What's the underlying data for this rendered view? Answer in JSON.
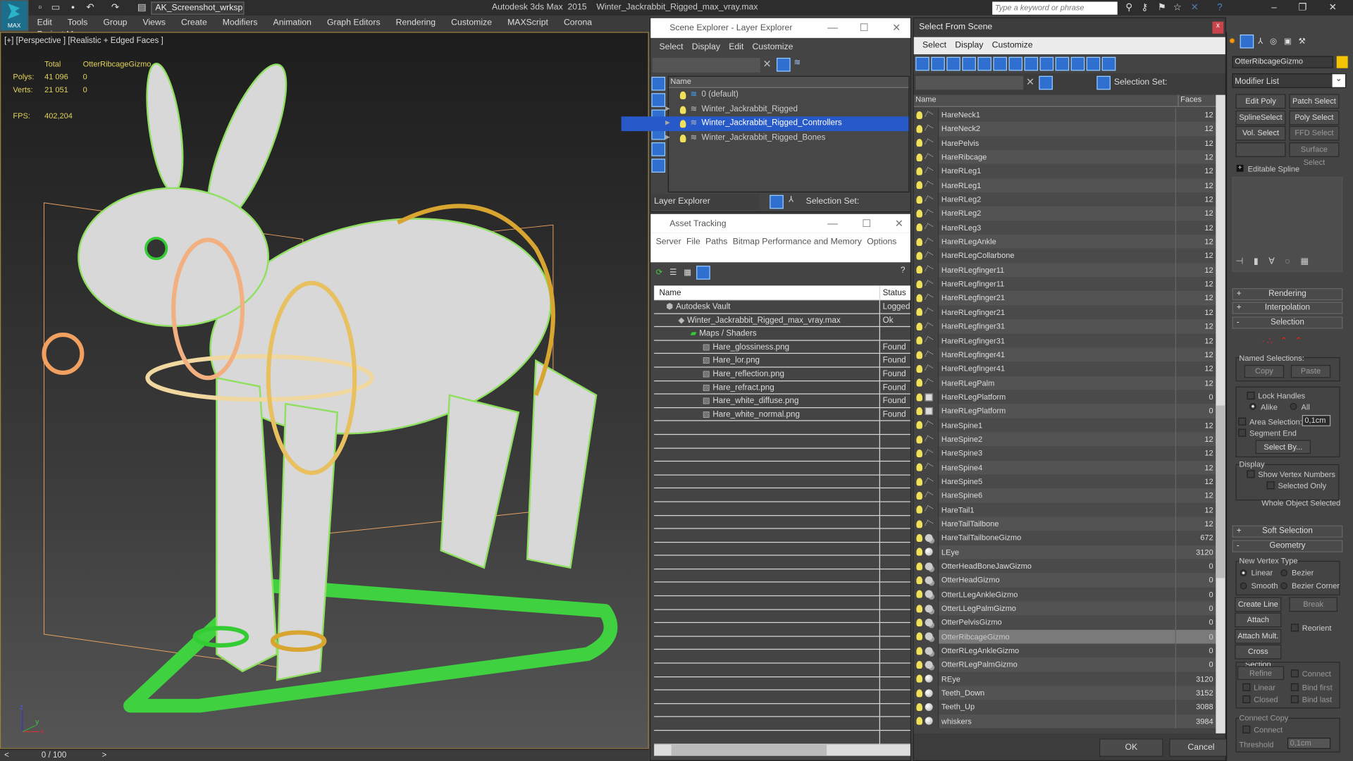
{
  "app": {
    "logo": "MAX",
    "workspace": "AK_Screenshot_wrksp",
    "title": "Autodesk 3ds Max  2015    Winter_Jackrabbit_Rigged_max_vray.max",
    "search_placeholder": "Type a keyword or phrase",
    "window_controls": [
      "minimize-icon",
      "restore-icon",
      "close-icon"
    ]
  },
  "menu": [
    "Edit",
    "Tools",
    "Group",
    "Views",
    "Create",
    "Modifiers",
    "Animation",
    "Graph Editors",
    "Rendering",
    "Customize",
    "MAXScript",
    "Corona",
    "Project Man"
  ],
  "viewport": {
    "label": "[+] [Perspective ] [Realistic + Edged Faces ]",
    "stats": {
      "col_total": "Total",
      "col_sel": "OtterRibcageGizmo",
      "polys_label": "Polys:",
      "polys_total": "41 096",
      "polys_sel": "0",
      "verts_label": "Verts:",
      "verts_total": "21 051",
      "verts_sel": "0",
      "fps_label": "FPS:",
      "fps": "402,204"
    },
    "axis": {
      "x": "x",
      "y": "y",
      "z": "z"
    }
  },
  "timeline": {
    "prev": "<",
    "frame": "0 / 100",
    "next": ">"
  },
  "scene_explorer": {
    "title": "Scene Explorer - Layer Explorer",
    "menu": [
      "Select",
      "Display",
      "Edit",
      "Customize"
    ],
    "column": "Name",
    "layers": [
      {
        "name": "0 (default)",
        "expandable": false,
        "selected": false
      },
      {
        "name": "Winter_Jackrabbit_Rigged",
        "expandable": true,
        "selected": false
      },
      {
        "name": "Winter_Jackrabbit_Rigged_Controllers",
        "expandable": true,
        "selected": true
      },
      {
        "name": "Winter_Jackrabbit_Rigged_Bones",
        "expandable": true,
        "selected": false
      }
    ],
    "mode": "Layer Explorer",
    "selection_set_label": "Selection Set:"
  },
  "asset_tracking": {
    "title": "Asset Tracking",
    "menu": [
      "Server",
      "File",
      "Paths",
      "Bitmap Performance and Memory",
      "Options"
    ],
    "columns": [
      "Name",
      "Status"
    ],
    "rows": [
      {
        "name": "Autodesk Vault",
        "status": "Logged",
        "indent": 1
      },
      {
        "name": "Winter_Jackrabbit_Rigged_max_vray.max",
        "status": "Ok",
        "indent": 2
      },
      {
        "name": "Maps / Shaders",
        "status": "",
        "indent": 3
      },
      {
        "name": "Hare_glossiness.png",
        "status": "Found",
        "indent": 4
      },
      {
        "name": "Hare_lor.png",
        "status": "Found",
        "indent": 4
      },
      {
        "name": "Hare_reflection.png",
        "status": "Found",
        "indent": 4
      },
      {
        "name": "Hare_refract.png",
        "status": "Found",
        "indent": 4
      },
      {
        "name": "Hare_white_diffuse.png",
        "status": "Found",
        "indent": 4
      },
      {
        "name": "Hare_white_normal.png",
        "status": "Found",
        "indent": 4
      }
    ]
  },
  "select_from_scene": {
    "title": "Select From Scene",
    "close": "x",
    "menu": [
      "Select",
      "Display",
      "Customize"
    ],
    "selection_set_label": "Selection Set:",
    "columns": [
      "Name",
      "Faces"
    ],
    "ok": "OK",
    "cancel": "Cancel",
    "rows": [
      {
        "n": "HareNeck1",
        "f": "12",
        "t": "bone"
      },
      {
        "n": "HareNeck2",
        "f": "12",
        "t": "bone"
      },
      {
        "n": "HarePelvis",
        "f": "12",
        "t": "bone"
      },
      {
        "n": "HareRibcage",
        "f": "12",
        "t": "bone"
      },
      {
        "n": "HareRLeg1",
        "f": "12",
        "t": "bone"
      },
      {
        "n": "HareRLeg1",
        "f": "12",
        "t": "bone"
      },
      {
        "n": "HareRLeg2",
        "f": "12",
        "t": "bone"
      },
      {
        "n": "HareRLeg2",
        "f": "12",
        "t": "bone"
      },
      {
        "n": "HareRLeg3",
        "f": "12",
        "t": "bone"
      },
      {
        "n": "HareRLegAnkle",
        "f": "12",
        "t": "bone"
      },
      {
        "n": "HareRLegCollarbone",
        "f": "12",
        "t": "bone"
      },
      {
        "n": "HareRLegfinger11",
        "f": "12",
        "t": "bone"
      },
      {
        "n": "HareRLegfinger11",
        "f": "12",
        "t": "bone"
      },
      {
        "n": "HareRLegfinger21",
        "f": "12",
        "t": "bone"
      },
      {
        "n": "HareRLegfinger21",
        "f": "12",
        "t": "bone"
      },
      {
        "n": "HareRLegfinger31",
        "f": "12",
        "t": "bone"
      },
      {
        "n": "HareRLegfinger31",
        "f": "12",
        "t": "bone"
      },
      {
        "n": "HareRLegfinger41",
        "f": "12",
        "t": "bone"
      },
      {
        "n": "HareRLegfinger41",
        "f": "12",
        "t": "bone"
      },
      {
        "n": "HareRLegPalm",
        "f": "12",
        "t": "bone"
      },
      {
        "n": "HareRLegPlatform",
        "f": "0",
        "t": "shape"
      },
      {
        "n": "HareRLegPlatform",
        "f": "0",
        "t": "shape"
      },
      {
        "n": "HareSpine1",
        "f": "12",
        "t": "bone"
      },
      {
        "n": "HareSpine2",
        "f": "12",
        "t": "bone"
      },
      {
        "n": "HareSpine3",
        "f": "12",
        "t": "bone"
      },
      {
        "n": "HareSpine4",
        "f": "12",
        "t": "bone"
      },
      {
        "n": "HareSpine5",
        "f": "12",
        "t": "bone"
      },
      {
        "n": "HareSpine6",
        "f": "12",
        "t": "bone"
      },
      {
        "n": "HareTail1",
        "f": "12",
        "t": "bone"
      },
      {
        "n": "HareTailTailbone",
        "f": "12",
        "t": "bone"
      },
      {
        "n": "HareTailTailboneGizmo",
        "f": "672",
        "t": "gizmo"
      },
      {
        "n": "LEye",
        "f": "3120",
        "t": "sphere"
      },
      {
        "n": "OtterHeadBoneJawGizmo",
        "f": "0",
        "t": "gizmo"
      },
      {
        "n": "OtterHeadGizmo",
        "f": "0",
        "t": "gizmo"
      },
      {
        "n": "OtterLLegAnkleGizmo",
        "f": "0",
        "t": "gizmo"
      },
      {
        "n": "OtterLLegPalmGizmo",
        "f": "0",
        "t": "gizmo"
      },
      {
        "n": "OtterPelvisGizmo",
        "f": "0",
        "t": "gizmo"
      },
      {
        "n": "OtterRibcageGizmo",
        "f": "0",
        "t": "gizmo",
        "selected": true
      },
      {
        "n": "OtterRLegAnkleGizmo",
        "f": "0",
        "t": "gizmo"
      },
      {
        "n": "OtterRLegPalmGizmo",
        "f": "0",
        "t": "gizmo"
      },
      {
        "n": "REye",
        "f": "3120",
        "t": "sphere"
      },
      {
        "n": "Teeth_Down",
        "f": "3152",
        "t": "sphere"
      },
      {
        "n": "Teeth_Up",
        "f": "3088",
        "t": "sphere"
      },
      {
        "n": "whiskers",
        "f": "3984",
        "t": "sphere"
      }
    ]
  },
  "command_panel": {
    "object_name": "OtterRibcageGizmo",
    "object_color": "#f5c400",
    "modifier_list": "Modifier List",
    "modifier_buttons": [
      "Edit Poly",
      "Patch Select",
      "SplineSelect",
      "Poly Select",
      "Vol. Select",
      "FFD Select",
      "",
      "Surface Select"
    ],
    "stack_item": "Editable Spline",
    "rollouts": {
      "rendering": "Rendering",
      "interpolation": "Interpolation",
      "selection": "Selection",
      "soft_selection": "Soft Selection",
      "geometry": "Geometry"
    },
    "selection": {
      "named_selections": "Named Selections:",
      "copy": "Copy",
      "paste": "Paste",
      "lock_handles": "Lock Handles",
      "alike": "Alike",
      "all": "All",
      "area_selection": "Area Selection:",
      "area_value": "0,1cm",
      "segment_end": "Segment End",
      "select_by": "Select By...",
      "display": "Display",
      "show_vertex_numbers": "Show Vertex Numbers",
      "selected_only": "Selected Only",
      "status": "Whole Object Selected"
    },
    "geometry": {
      "new_vertex_type": "New Vertex Type",
      "linear": "Linear",
      "bezier": "Bezier",
      "smooth": "Smooth",
      "bezier_corner": "Bezier Corner",
      "create_line": "Create Line",
      "break": "Break",
      "attach": "Attach",
      "reorient": "Reorient",
      "attach_mult": "Attach Mult.",
      "cross_section": "Cross Section",
      "refine": "Refine",
      "connect": "Connect",
      "linear2": "Linear",
      "bind_first": "Bind first",
      "closed": "Closed",
      "bind_last": "Bind last",
      "connect_copy": "Connect Copy",
      "connect2": "Connect",
      "threshold": "Threshold",
      "threshold_value": "0,1cm"
    }
  }
}
